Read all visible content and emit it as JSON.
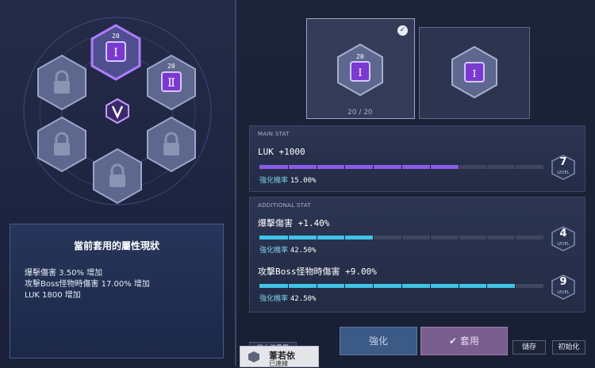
{
  "hexagon_slots": {
    "top_gem_level": "20",
    "right_gem_level": "20",
    "top_gem_icon": "roman-numeral-one-gem-icon",
    "right_gem_icon": "roman-numeral-two-gem-icon",
    "center_emblem": "v-emblem-icon",
    "locked_icon": "lock-icon"
  },
  "current_attributes": {
    "title": "當前套用的屬性現狀",
    "lines": [
      "爆擊傷害 3.50% 增加",
      "攻擊Boss怪物時傷害 17.00% 增加",
      "LUK 1800 增加"
    ]
  },
  "selection": {
    "card1_level": "20",
    "card2_level": "",
    "progress": "20 / 20",
    "selected_icon": "check-icon"
  },
  "main_stat": {
    "header": "MAIN STAT",
    "name": "LUK +1000",
    "rate_label": "強化機率",
    "rate_value": "15.00%",
    "level": "7",
    "level_word": "LEVEL",
    "fill": 0.7
  },
  "additional_stat": {
    "header": "ADDITIONAL STAT",
    "stats": [
      {
        "name": "爆擊傷害 +1.40%",
        "rate_label": "強化機率",
        "rate_value": "42.50%",
        "level": "4",
        "level_word": "LEVEL",
        "fill": 0.4
      },
      {
        "name": "攻擊Boss怪物時傷害 +9.00%",
        "rate_label": "強化機率",
        "rate_value": "42.50%",
        "level": "9",
        "level_word": "LEVEL",
        "fill": 0.9
      }
    ]
  },
  "buttons": {
    "enhance": "強化",
    "apply": "套用",
    "save": "儲存",
    "initialize": "初始化",
    "reset_tab": "能力值重置"
  },
  "notice": {
    "name": "葦若依",
    "sub": "已連線"
  },
  "colors": {
    "main_bar": "#8a5ce8",
    "add_bar": "#3fc3e8",
    "accent_purple": "#8a5ce8"
  }
}
